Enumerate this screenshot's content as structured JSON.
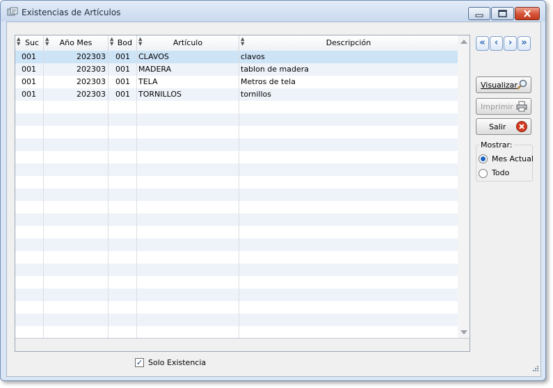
{
  "window": {
    "title": "Existencias de Artículos"
  },
  "grid": {
    "columns": [
      {
        "key": "suc",
        "label": "Suc"
      },
      {
        "key": "anio_mes",
        "label": "Año Mes"
      },
      {
        "key": "bod",
        "label": "Bod"
      },
      {
        "key": "articulo",
        "label": "Artículo"
      },
      {
        "key": "descripcion",
        "label": "Descripción"
      }
    ],
    "rows": [
      {
        "suc": "001",
        "anio_mes": "202303",
        "bod": "001",
        "articulo": "CLAVOS",
        "descripcion": "clavos"
      },
      {
        "suc": "001",
        "anio_mes": "202303",
        "bod": "001",
        "articulo": "MADERA",
        "descripcion": "tablon de madera"
      },
      {
        "suc": "001",
        "anio_mes": "202303",
        "bod": "001",
        "articulo": "TELA",
        "descripcion": "Metros de tela"
      },
      {
        "suc": "001",
        "anio_mes": "202303",
        "bod": "001",
        "articulo": "TORNILLOS",
        "descripcion": "tornillos"
      }
    ]
  },
  "nav": {
    "first": "«",
    "prev": "‹",
    "next": "›",
    "last": "»"
  },
  "buttons": {
    "visualizar": {
      "label": "Visualizar",
      "icon": "magnifier-icon"
    },
    "imprimir": {
      "label": "Imprimir",
      "icon": "printer-icon"
    },
    "salir": {
      "label": "Salir",
      "icon": "close-circle-icon"
    }
  },
  "mostrar": {
    "title": "Mostrar:",
    "options": [
      {
        "label": "Mes Actual",
        "selected": true
      },
      {
        "label": "Todo",
        "selected": false
      }
    ]
  },
  "solo_existencia": {
    "label": "Solo Existencia",
    "checked": true
  }
}
